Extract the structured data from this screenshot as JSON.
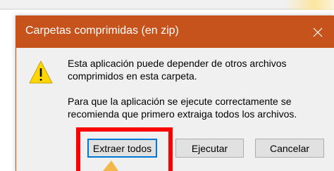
{
  "dialog": {
    "title": "Carpetas comprimidas (en zip)",
    "close_icon": "close-icon",
    "warning_icon": "warning-icon",
    "message_1": "Esta aplicación puede depender de otros archivos comprimidos en esta carpeta.",
    "message_2": "Para que la aplicación se ejecute correctamente se recomienda que primero extraiga todos los archivos.",
    "buttons": {
      "extract_all": "Extraer todos",
      "run": "Ejecutar",
      "cancel": "Cancelar"
    }
  },
  "colors": {
    "titlebar": "#c6531c",
    "dialog_bg": "#f0f0f0",
    "highlight": "#ff0000",
    "focus_border": "#0078d7",
    "warning_fill": "#ffd700",
    "pointer": "#f2b94a"
  }
}
